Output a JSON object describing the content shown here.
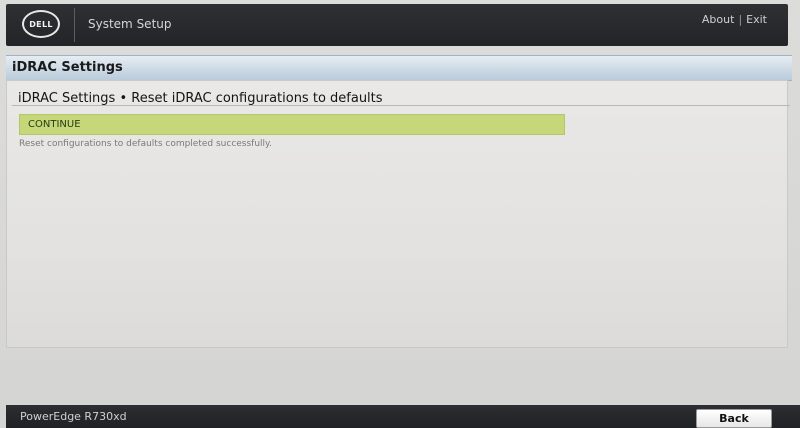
{
  "header": {
    "logo_text": "DELL",
    "app_title": "System Setup",
    "about_label": "About",
    "separator": "|",
    "exit_label": "Exit"
  },
  "section": {
    "title": "iDRAC Settings"
  },
  "main": {
    "heading": "iDRAC Settings • Reset iDRAC configurations to defaults",
    "continue_label": "CONTINUE",
    "status_message": "Reset configurations to defaults completed successfully."
  },
  "footer": {
    "model": "PowerEdge R730xd",
    "back_label": "Back"
  },
  "colors": {
    "topbar": "#2e3033",
    "header_band": "#b9cbdb",
    "continue_highlight": "#c6d77a",
    "panel": "#e6e5e3"
  }
}
